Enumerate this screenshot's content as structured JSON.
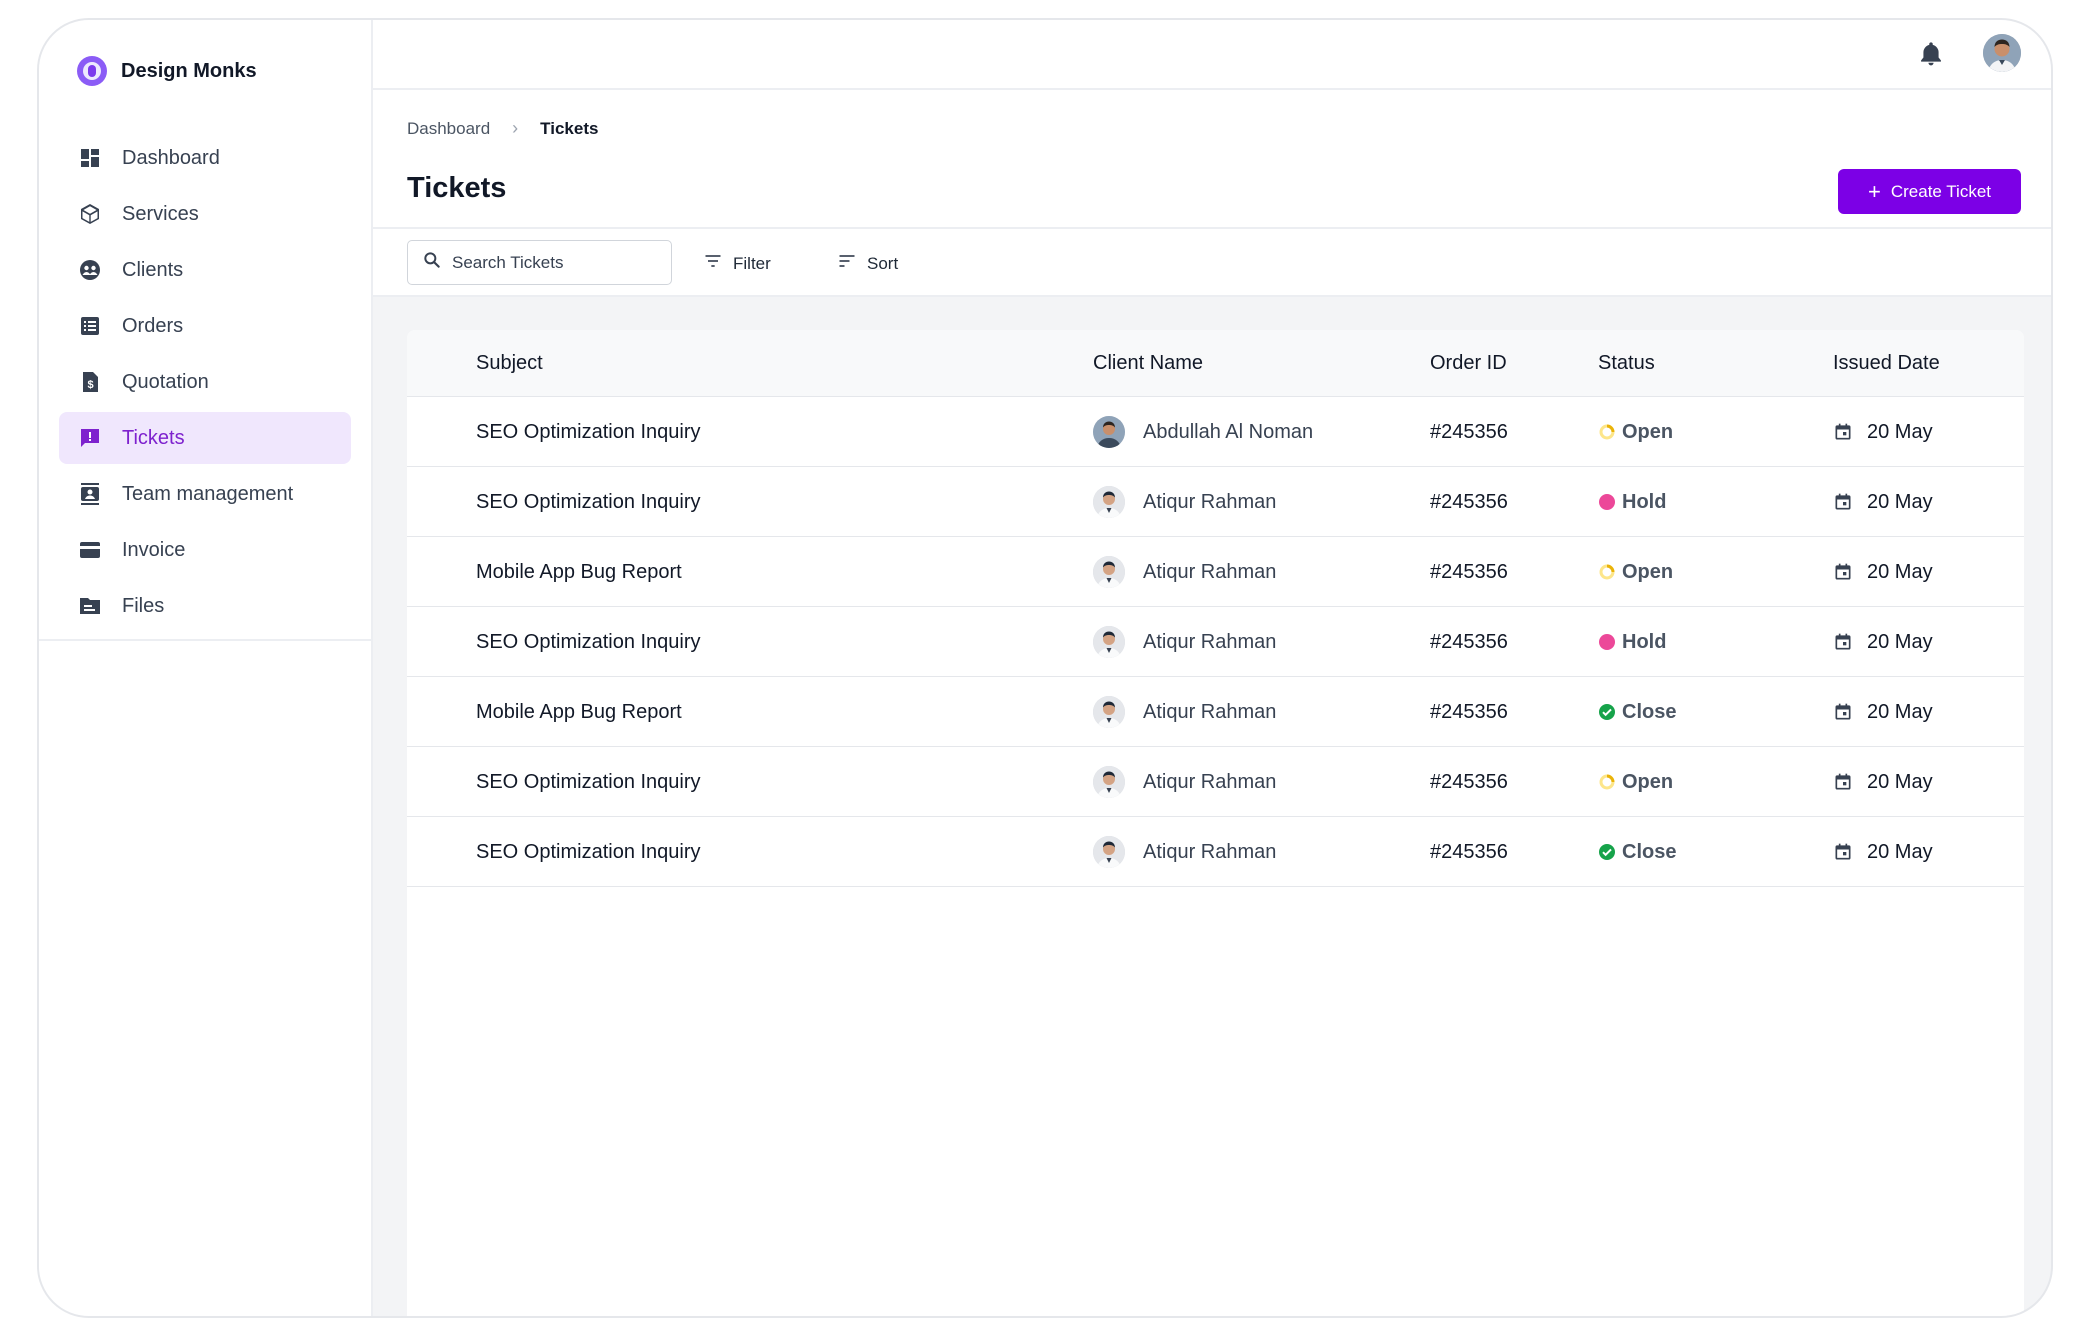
{
  "brand": {
    "name": "Design Monks"
  },
  "sidebar": {
    "items": [
      {
        "label": "Dashboard",
        "icon": "dashboard-icon",
        "active": false
      },
      {
        "label": "Services",
        "icon": "cube-icon",
        "active": false
      },
      {
        "label": "Clients",
        "icon": "clients-icon",
        "active": false
      },
      {
        "label": "Orders",
        "icon": "list-icon",
        "active": false
      },
      {
        "label": "Quotation",
        "icon": "dollar-file-icon",
        "active": false
      },
      {
        "label": "Tickets",
        "icon": "ticket-chat-icon",
        "active": true
      },
      {
        "label": "Team management",
        "icon": "contact-icon",
        "active": false
      },
      {
        "label": "Invoice",
        "icon": "card-icon",
        "active": false
      },
      {
        "label": "Files",
        "icon": "folder-icon",
        "active": false
      }
    ]
  },
  "breadcrumb": {
    "parent": "Dashboard",
    "current": "Tickets"
  },
  "page": {
    "title": "Tickets"
  },
  "actions": {
    "create_label": "Create Ticket"
  },
  "toolbar": {
    "search_placeholder": "Search Tickets",
    "filter_label": "Filter",
    "sort_label": "Sort"
  },
  "table": {
    "headers": {
      "subject": "Subject",
      "client": "Client Name",
      "order": "Order ID",
      "status": "Status",
      "date": "Issued Date"
    },
    "rows": [
      {
        "subject": "SEO Optimization Inquiry",
        "client": "Abdullah Al Noman",
        "order": "#245356",
        "status": "Open",
        "date": "20 May"
      },
      {
        "subject": "SEO Optimization Inquiry",
        "client": "Atiqur Rahman",
        "order": "#245356",
        "status": "Hold",
        "date": "20 May"
      },
      {
        "subject": "Mobile App Bug Report",
        "client": "Atiqur Rahman",
        "order": "#245356",
        "status": "Open",
        "date": "20 May"
      },
      {
        "subject": "SEO Optimization Inquiry",
        "client": "Atiqur Rahman",
        "order": "#245356",
        "status": "Hold",
        "date": "20 May"
      },
      {
        "subject": "Mobile App Bug Report",
        "client": "Atiqur Rahman",
        "order": "#245356",
        "status": "Close",
        "date": "20 May"
      },
      {
        "subject": "SEO Optimization Inquiry",
        "client": "Atiqur Rahman",
        "order": "#245356",
        "status": "Open",
        "date": "20 May"
      },
      {
        "subject": "SEO Optimization Inquiry",
        "client": "Atiqur Rahman",
        "order": "#245356",
        "status": "Close",
        "date": "20 May"
      }
    ]
  },
  "colors": {
    "accent": "#7c00e6",
    "active_bg": "#f0e7fd",
    "open": "#facc15",
    "hold": "#ec4899",
    "close": "#16a34a"
  }
}
